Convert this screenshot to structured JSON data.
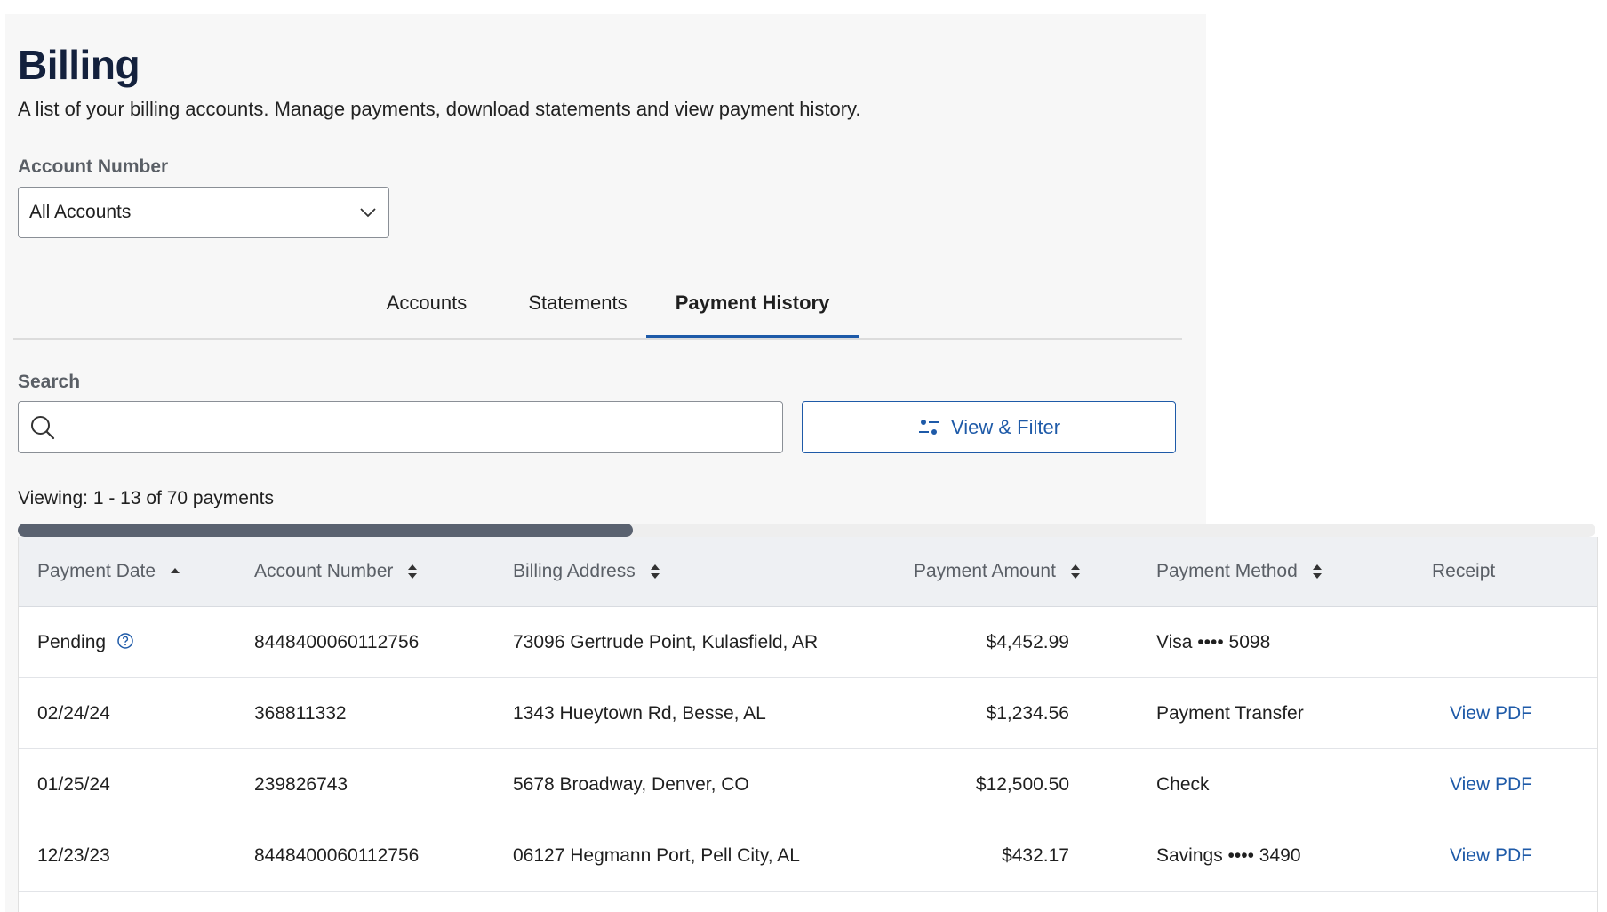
{
  "page": {
    "title": "Billing",
    "subtitle": "A list of your billing accounts. Manage payments, download statements and view payment history."
  },
  "account_filter": {
    "label": "Account Number",
    "selected": "All Accounts",
    "icon": "chevron-down-icon"
  },
  "tabs": [
    {
      "label": "Accounts",
      "active": false
    },
    {
      "label": "Statements",
      "active": false
    },
    {
      "label": "Payment History",
      "active": true
    }
  ],
  "search": {
    "label": "Search",
    "value": "",
    "placeholder": "",
    "icon": "search-icon"
  },
  "filter_button": {
    "label": "View & Filter",
    "icon": "filter-sliders-icon"
  },
  "viewing_text": "Viewing: 1 - 13 of 70 payments",
  "horizontal_scroll": {
    "position_fraction": 0.39
  },
  "table": {
    "columns": [
      {
        "label": "Payment Date",
        "sort": "ascending"
      },
      {
        "label": "Account Number",
        "sort": "sortable"
      },
      {
        "label": "Billing Address",
        "sort": "sortable"
      },
      {
        "label": "Payment Amount",
        "sort": "sortable"
      },
      {
        "label": "Payment Method",
        "sort": "sortable"
      },
      {
        "label": "Receipt",
        "sort": "none"
      }
    ],
    "rows": [
      {
        "date": "Pending",
        "account": "8448400060112756",
        "address": "73096 Gertrude Point, Kulasfield, AR",
        "amount": "$4,452.99",
        "method": "Visa •••• 5098",
        "receipt": "",
        "date_help_icon": "question-circle-icon"
      },
      {
        "date": "02/24/24",
        "account": "368811332",
        "address": "1343 Hueytown Rd, Besse, AL",
        "amount": "$1,234.56",
        "method": "Payment Transfer",
        "receipt": "View PDF"
      },
      {
        "date": "01/25/24",
        "account": "239826743",
        "address": "5678 Broadway, Denver, CO",
        "amount": "$12,500.50",
        "method": "Check",
        "receipt": "View PDF"
      },
      {
        "date": "12/23/23",
        "account": "8448400060112756",
        "address": "06127 Hegmann Port, Pell City, AL",
        "amount": "$432.17",
        "method": "Savings •••• 3490",
        "receipt": "View PDF"
      }
    ]
  },
  "colors": {
    "heading": "#14213d",
    "accent": "#1e5aa8",
    "panel_bg": "#f7f7f7",
    "table_header_bg": "#eef0f3",
    "scrollbar_thumb": "#5a6270"
  }
}
